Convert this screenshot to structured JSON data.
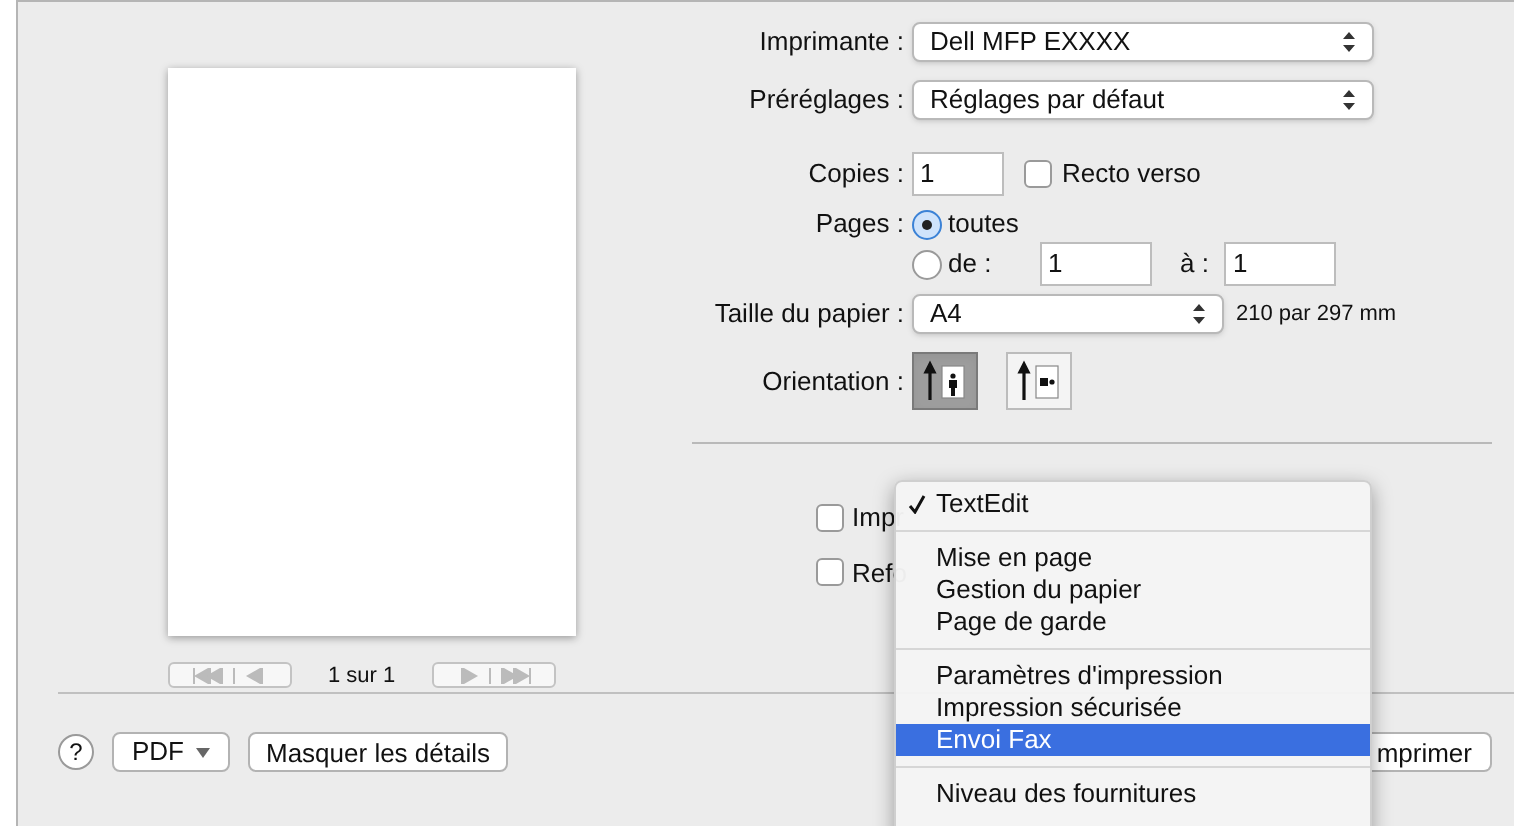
{
  "preview": {
    "page_label": "1 sur 1"
  },
  "printer": {
    "label": "Imprimante :",
    "value": "Dell MFP EXXXX"
  },
  "presets": {
    "label": "Préréglages :",
    "value": "Réglages par défaut"
  },
  "copies": {
    "label": "Copies :",
    "value": "1"
  },
  "two_sided": {
    "label": "Recto verso",
    "checked": false
  },
  "pages": {
    "label": "Pages :",
    "options": [
      {
        "label": "toutes",
        "selected": true
      },
      {
        "label": "de :",
        "selected": false
      }
    ],
    "from": "1",
    "to_label": "à :",
    "to": "1"
  },
  "paper_size": {
    "label": "Taille du papier :",
    "value": "A4",
    "dimensions": "210 par 297 mm"
  },
  "orientation": {
    "label": "Orientation :",
    "options": [
      {
        "kind": "portrait",
        "selected": true
      },
      {
        "kind": "landscape",
        "selected": false
      }
    ]
  },
  "app_options": [
    {
      "label": "Impr",
      "checked": false
    },
    {
      "label": "Refo",
      "checked": false
    }
  ],
  "menu": {
    "groups": [
      [
        {
          "label": "TextEdit",
          "checked": true,
          "selected": false
        }
      ],
      [
        {
          "label": "Mise en page",
          "checked": false,
          "selected": false
        },
        {
          "label": "Gestion du papier",
          "checked": false,
          "selected": false
        },
        {
          "label": "Page de garde",
          "checked": false,
          "selected": false
        }
      ],
      [
        {
          "label": "Paramètres d'impression",
          "checked": false,
          "selected": false
        },
        {
          "label": "Impression sécurisée",
          "checked": false,
          "selected": false
        },
        {
          "label": "Envoi Fax",
          "checked": false,
          "selected": true
        }
      ],
      [
        {
          "label": "Niveau des fournitures",
          "checked": false,
          "selected": false
        }
      ]
    ]
  },
  "bottom": {
    "help": "?",
    "pdf": "PDF",
    "details": "Masquer les détails",
    "print": "mprimer"
  }
}
